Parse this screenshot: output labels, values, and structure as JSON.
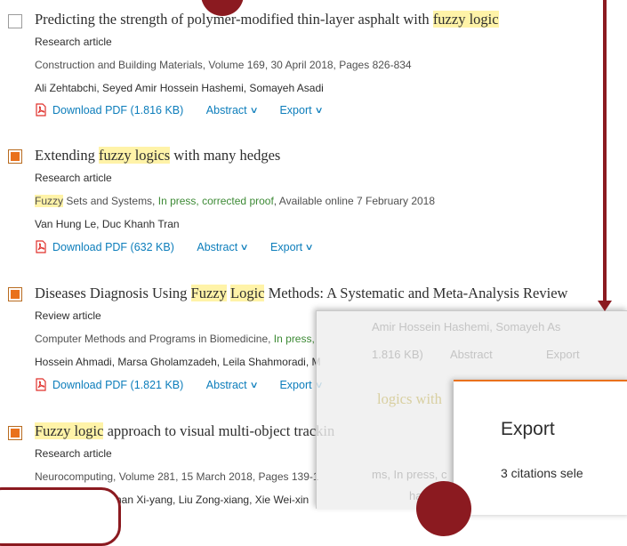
{
  "results": [
    {
      "title_pre": "Predicting the strength of polymer-modified thin-layer asphalt with ",
      "title_hl": "fuzzy logic",
      "title_post": "",
      "type": "Research article",
      "source": "Construction and Building Materials, Volume 169, 30 April 2018, Pages 826-834",
      "authors": "Ali Zehtabchi, Seyed Amir Hossein Hashemi, Somayeh Asadi",
      "pdf_label": "Download PDF (1.816 KB)",
      "abstract_label": "Abstract",
      "export_label": "Export",
      "checked": false
    },
    {
      "title_pre": "Extending ",
      "title_hl": "fuzzy logics",
      "title_post": " with many hedges",
      "type": "Research article",
      "source_hl": "Fuzzy",
      "source_mid": " Sets and Systems, ",
      "source_green": "In press, corrected proof",
      "source_post": ", Available online 7 February 2018",
      "authors": "Van Hung Le, Duc Khanh Tran",
      "pdf_label": "Download PDF (632 KB)",
      "abstract_label": "Abstract",
      "export_label": "Export",
      "checked": true
    },
    {
      "title_pre": "Diseases Diagnosis Using ",
      "title_hl1": "Fuzzy",
      "title_mid": " ",
      "title_hl2": "Logic",
      "title_post": " Methods: A Systematic and Meta-Analysis Review",
      "type": "Review article",
      "source": "Computer Methods and Programs in Biomedicine, ",
      "source_green": "In press,",
      "authors": "Hossein Ahmadi, Marsa Gholamzadeh, Leila Shahmoradi, M",
      "pdf_label": "Download PDF (1.821 KB)",
      "abstract_label": "Abstract",
      "export_label": "Export",
      "checked": true
    },
    {
      "title_hl": "Fuzzy logic",
      "title_post": " approach to visual multi-object trackin",
      "type": "Research article",
      "source": "Neurocomputing, Volume 281, 15 March 2018, Pages 139-1",
      "authors": "han Xi-yang, Liu Zong-xiang, Xie Wei-xin",
      "checked": true
    }
  ],
  "overlay": {
    "ghost_authors": "Amir Hossein Hashemi, Somayeh As",
    "ghost_pdf": "1.816 KB)",
    "ghost_abstract": "Abstract",
    "ghost_export": "Export",
    "ghost_title": "logics with",
    "ghost_source": "ms, In press, c",
    "ghost_authors2": "hanh Tr"
  },
  "modal": {
    "title": "Export",
    "subtitle": "3 citations sele"
  },
  "colors": {
    "accent": "#e9711c",
    "link": "#0c7dbb",
    "highlight": "#fff3a8",
    "annotation": "#8b1a20",
    "in_press": "#3d8a35"
  }
}
